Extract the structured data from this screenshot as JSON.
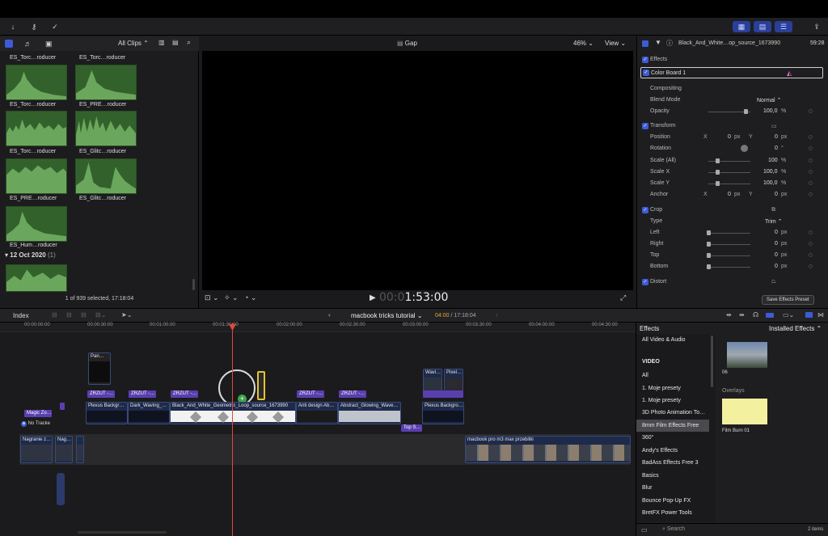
{
  "toolbar": {
    "save_effects_preset": "Save Effects Preset"
  },
  "browser": {
    "filter_label": "All Clips",
    "clip_labels": [
      "ES_Torc…roducer",
      "ES_Torc…roducer",
      "ES_Torc…roducer",
      "ES_PRE…roducer",
      "ES_Torc…roducer",
      "ES_Glitc…roducer",
      "ES_PRE…roducer",
      "ES_Glitc…roducer",
      "ES_Hum…roducer"
    ],
    "date_group": "12 Oct 2020",
    "date_group_count": "(1)",
    "status": "1 of 939 selected, 17:18:04"
  },
  "viewer": {
    "title": "Gap",
    "zoom": "46%",
    "view_label": "View",
    "timecode_dim": "00:0",
    "timecode": "1:53:00"
  },
  "inspector": {
    "clip_name": "Black_And_White…op_source_1673990",
    "duration": "59:28",
    "effects_label": "Effects",
    "color_board": "Color Board 1",
    "compositing": "Compositing",
    "blend_mode_label": "Blend Mode",
    "blend_mode_value": "Normal",
    "opacity_label": "Opacity",
    "opacity_value": "100,0",
    "transform": "Transform",
    "position_label": "Position",
    "pos_x": "0",
    "pos_y": "0",
    "rotation_label": "Rotation",
    "rotation_value": "0",
    "scale_all_label": "Scale (All)",
    "scale_all_value": "100",
    "scale_x_label": "Scale X",
    "scale_x_value": "100,0",
    "scale_y_label": "Scale Y",
    "scale_y_value": "100,0",
    "anchor_label": "Anchor",
    "anchor_x": "0",
    "anchor_y": "0",
    "crop": "Crop",
    "type_label": "Type",
    "type_value": "Trim",
    "left_label": "Left",
    "left_value": "0",
    "right_label": "Right",
    "right_value": "0",
    "top_label": "Top",
    "top_value": "0",
    "bottom_label": "Bottom",
    "bottom_value": "0",
    "distort": "Distort",
    "unit_px": "px",
    "unit_pct": "%",
    "unit_deg": "°",
    "x_letter": "X",
    "y_letter": "Y"
  },
  "timeline_bar": {
    "index_label": "Index",
    "project_name": "macbook tricks tutorial",
    "playhead_time": "04:00",
    "total_time": "17:18:04"
  },
  "ruler": [
    "00:00:00:00",
    "00:00:30:00",
    "00:01:00:00",
    "00:01:30:00",
    "00:02:00:00",
    "00:02:30:00",
    "00:03:00:00",
    "00:03:30:00",
    "00:04:00:00",
    "00:04:30:00"
  ],
  "timeline": {
    "titles": [
      "ZRZUT -…",
      "ZRZUT -…",
      "ZRZUT -…",
      "ZRZUT -…",
      "ZRZUT -…"
    ],
    "pan_clip": "Pan…",
    "wavi_clip": "Wavi…",
    "pixel_clip": "Pixel…",
    "magic_zoom": "Magic Zo…",
    "no_tracks": "No Tracke",
    "clips": [
      "Plexus Backgr…",
      "Dark_Waving_…",
      "Black_And_White_Geometric_Loop_source_1673990",
      "Anti design Ab…",
      "Abstract_Glowing_Wave…",
      "Plexus Backgro…"
    ],
    "top_s": "Top S…",
    "main_clips": [
      "Nagranie z…",
      "Nag…",
      "macbook pro m3 max przebitki"
    ]
  },
  "effects": {
    "header": "Effects",
    "installed": "Installed Effects",
    "categories": [
      "All Video & Audio",
      "VIDEO",
      "All",
      "1. Moje presety",
      "1. Moje presety",
      "3D Photo Animation To…",
      "8mm Film Effects Free",
      "360°",
      "Andy's Effects",
      "BadAss Effects Free 3",
      "Basics",
      "Blur",
      "Bounce Pop-Up FX",
      "BretFX Power Tools"
    ],
    "thumb_06": "06",
    "overlays": "Overlays",
    "film_burn": "Film Burn 01",
    "items_count": "2 items",
    "search_placeholder": "Search"
  },
  "colors": {
    "accent": "#3d5bd8",
    "clip_green": "#33612c",
    "title_purple": "#5a3fb0",
    "playhead": "#e0483c"
  }
}
